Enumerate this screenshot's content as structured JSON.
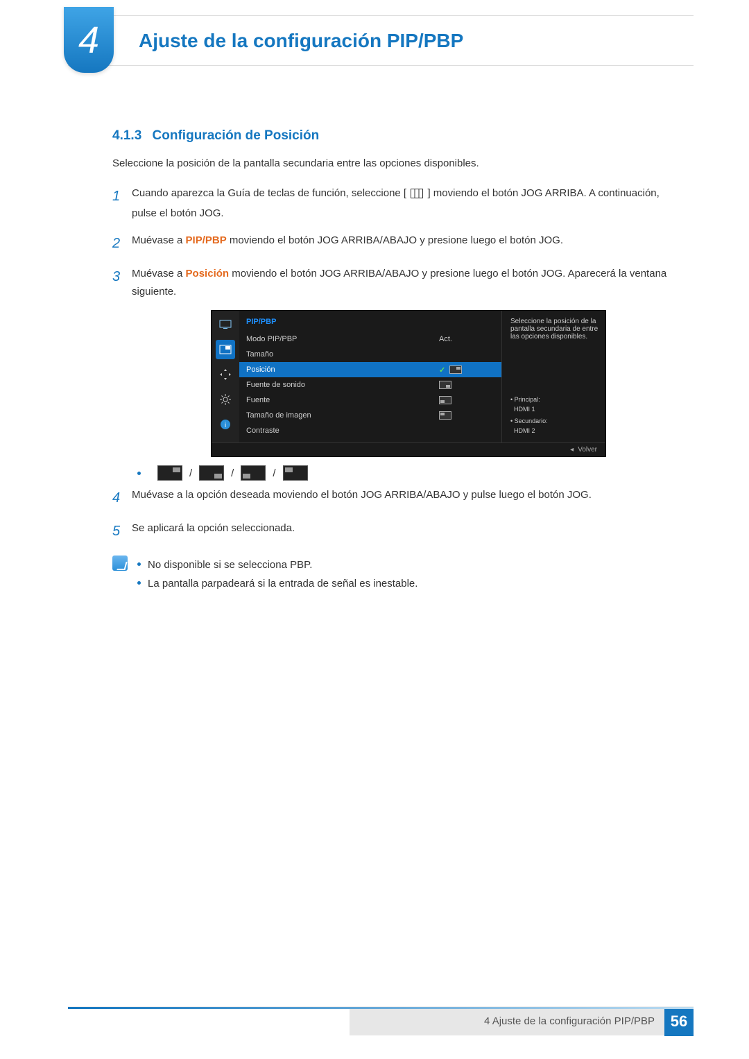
{
  "chapter": {
    "number": "4",
    "title": "Ajuste de la configuración PIP/PBP"
  },
  "section": {
    "number": "4.1.3",
    "title": "Configuración de Posición"
  },
  "intro": "Seleccione la posición de la pantalla secundaria entre las opciones disponibles.",
  "steps": {
    "s1a": "Cuando aparezca la Guía de teclas de función, seleccione [",
    "s1b": "] moviendo el botón JOG ARRIBA. A continuación, pulse el botón JOG.",
    "s2a": "Muévase a ",
    "s2_emph": "PIP/PBP",
    "s2b": " moviendo el botón JOG ARRIBA/ABAJO y presione luego el botón JOG.",
    "s3a": "Muévase a ",
    "s3_emph": "Posición",
    "s3b": " moviendo el botón JOG ARRIBA/ABAJO y presione luego el botón JOG. Aparecerá la ventana siguiente.",
    "s4": "Muévase a la opción deseada moviendo el botón JOG ARRIBA/ABAJO y pulse luego el botón JOG.",
    "s5": "Se aplicará la opción seleccionada."
  },
  "osd": {
    "title": "PIP/PBP",
    "rows": {
      "mode": "Modo PIP/PBP",
      "mode_v": "Act.",
      "size": "Tamaño",
      "pos": "Posición",
      "sound": "Fuente de sonido",
      "source": "Fuente",
      "imgsize": "Tamaño de imagen",
      "contrast": "Contraste"
    },
    "help": "Seleccione la posición de la pantalla secundaria de entre las opciones disponibles.",
    "main_lbl": "Principal:",
    "main_v": "HDMI 1",
    "sec_lbl": "Secundario:",
    "sec_v": "HDMI 2",
    "back": "Volver"
  },
  "sep": "/",
  "notes": {
    "n1": "No disponible si se selecciona PBP.",
    "n2": "La pantalla parpadeará si la entrada de señal es inestable."
  },
  "footer": {
    "text": "4 Ajuste de la configuración PIP/PBP",
    "page": "56"
  }
}
